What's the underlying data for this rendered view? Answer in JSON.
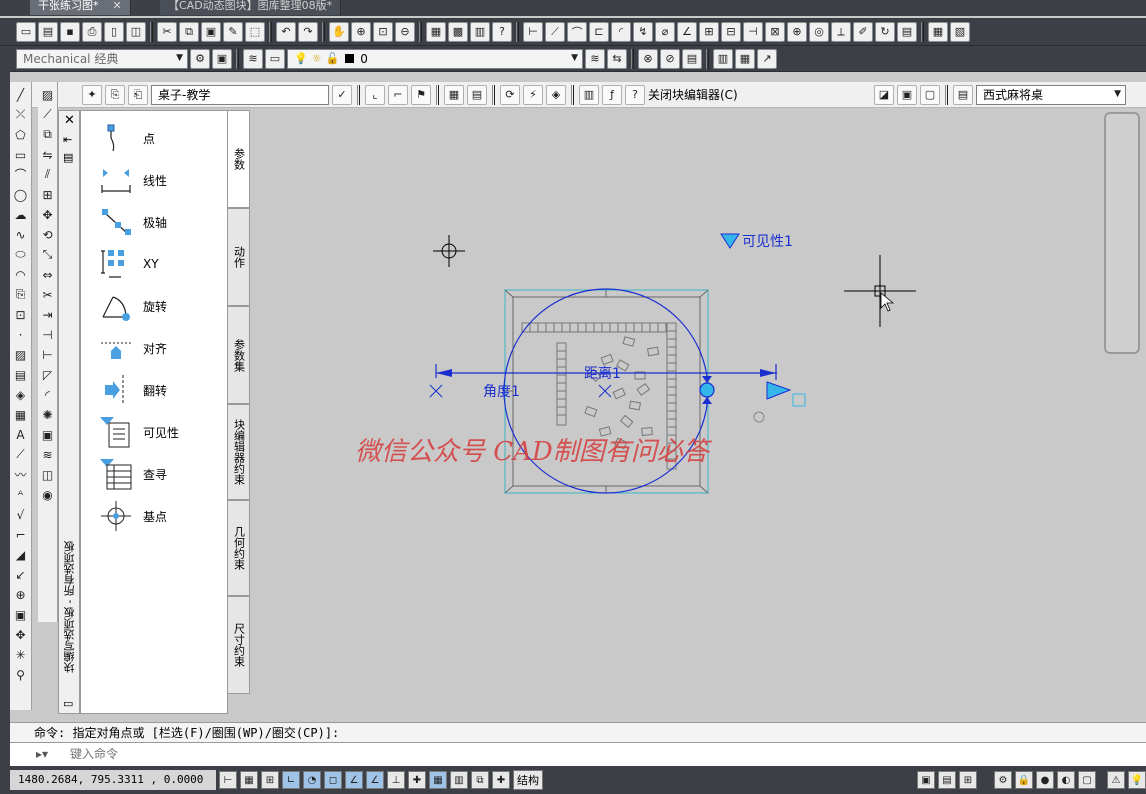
{
  "document_tabs": [
    {
      "label": "干张练习图*",
      "active": true
    },
    {
      "label": "【CAD动态图块】图库整理08版*",
      "active": false
    }
  ],
  "toolbar2": {
    "workspace": "Mechanical 经典",
    "layer": "0"
  },
  "block_editor": {
    "block_name": "桌子-教学",
    "close_label": "关闭块编辑器(C)",
    "visibility_state": "西式麻将桌"
  },
  "palette": {
    "title": "块编写选项板 - 所有选项板",
    "items": [
      {
        "label": "点",
        "icon": "point-param-icon"
      },
      {
        "label": "线性",
        "icon": "linear-param-icon"
      },
      {
        "label": "极轴",
        "icon": "polar-param-icon"
      },
      {
        "label": "XY",
        "icon": "xy-param-icon"
      },
      {
        "label": "旋转",
        "icon": "rotation-param-icon"
      },
      {
        "label": "对齐",
        "icon": "alignment-param-icon"
      },
      {
        "label": "翻转",
        "icon": "flip-param-icon"
      },
      {
        "label": "可见性",
        "icon": "visibility-param-icon"
      },
      {
        "label": "查寻",
        "icon": "lookup-param-icon"
      },
      {
        "label": "基点",
        "icon": "basepoint-param-icon"
      }
    ],
    "tabs": [
      "参数",
      "动作",
      "参数集",
      "块编辑器约束",
      "几何约束",
      "尺寸约束"
    ]
  },
  "canvas": {
    "visibility_label": "可见性1",
    "angle_label": "角度1",
    "distance_label": "距离1",
    "watermark": "微信公众号 CAD制图有问必答"
  },
  "command": {
    "history": "命令: 指定对角点或 [栏选(F)/圈围(WP)/圈交(CP)]:",
    "placeholder": "键入命令"
  },
  "status": {
    "coords": "1480.2684, 795.3311 , 0.0000",
    "structure_label": "结构"
  },
  "colors": {
    "param_blue": "#1a2fd0",
    "grip_cyan": "#35b6ea",
    "watermark_red": "#d63c3c",
    "table_cyan": "#3ab7c8"
  }
}
